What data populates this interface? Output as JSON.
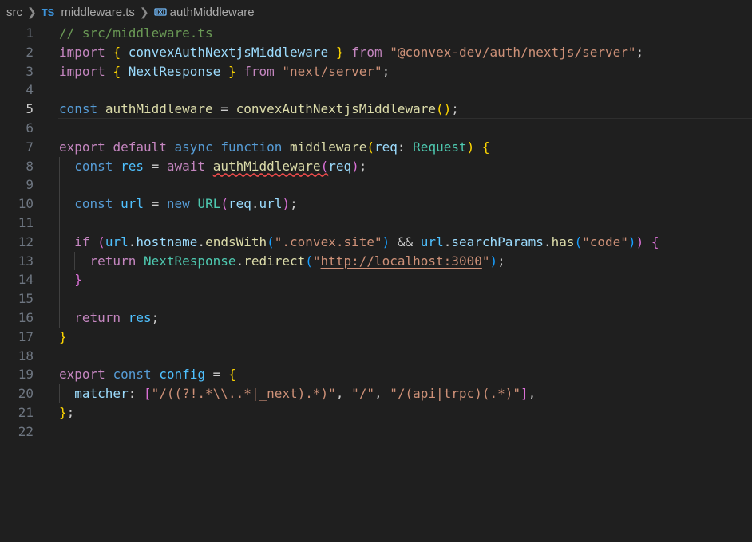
{
  "breadcrumb": {
    "folder": "src",
    "file_icon": "TS",
    "file": "middleware.ts",
    "symbol_icon": "symbol-variable-icon",
    "symbol": "authMiddleware"
  },
  "lines": [
    {
      "n": "1",
      "tokens": [
        {
          "t": "// src/middleware.ts",
          "c": "cm"
        }
      ]
    },
    {
      "n": "2",
      "tokens": [
        {
          "t": "import",
          "c": "k1"
        },
        {
          "t": " ",
          "c": "pl"
        },
        {
          "t": "{",
          "c": "b1"
        },
        {
          "t": " ",
          "c": "pl"
        },
        {
          "t": "convexAuthNextjsMiddleware",
          "c": "id"
        },
        {
          "t": " ",
          "c": "pl"
        },
        {
          "t": "}",
          "c": "b1"
        },
        {
          "t": " ",
          "c": "pl"
        },
        {
          "t": "from",
          "c": "k1"
        },
        {
          "t": " ",
          "c": "pl"
        },
        {
          "t": "\"@convex-dev/auth/nextjs/server\"",
          "c": "str"
        },
        {
          "t": ";",
          "c": "pl"
        }
      ]
    },
    {
      "n": "3",
      "tokens": [
        {
          "t": "import",
          "c": "k1"
        },
        {
          "t": " ",
          "c": "pl"
        },
        {
          "t": "{",
          "c": "b1"
        },
        {
          "t": " ",
          "c": "pl"
        },
        {
          "t": "NextResponse",
          "c": "id"
        },
        {
          "t": " ",
          "c": "pl"
        },
        {
          "t": "}",
          "c": "b1"
        },
        {
          "t": " ",
          "c": "pl"
        },
        {
          "t": "from",
          "c": "k1"
        },
        {
          "t": " ",
          "c": "pl"
        },
        {
          "t": "\"next/server\"",
          "c": "str"
        },
        {
          "t": ";",
          "c": "pl"
        }
      ]
    },
    {
      "n": "4",
      "tokens": []
    },
    {
      "n": "5",
      "current": true,
      "tokens": [
        {
          "t": "const",
          "c": "k2"
        },
        {
          "t": " ",
          "c": "pl"
        },
        {
          "t": "authMiddleware",
          "c": "fn"
        },
        {
          "t": " = ",
          "c": "pl"
        },
        {
          "t": "convexAuthNextjsMiddleware",
          "c": "fn"
        },
        {
          "t": "()",
          "c": "b1"
        },
        {
          "t": ";",
          "c": "pl"
        }
      ]
    },
    {
      "n": "6",
      "tokens": []
    },
    {
      "n": "7",
      "tokens": [
        {
          "t": "export",
          "c": "k1"
        },
        {
          "t": " ",
          "c": "pl"
        },
        {
          "t": "default",
          "c": "k1"
        },
        {
          "t": " ",
          "c": "pl"
        },
        {
          "t": "async",
          "c": "k2"
        },
        {
          "t": " ",
          "c": "pl"
        },
        {
          "t": "function",
          "c": "k2"
        },
        {
          "t": " ",
          "c": "pl"
        },
        {
          "t": "middleware",
          "c": "fn"
        },
        {
          "t": "(",
          "c": "b1"
        },
        {
          "t": "req",
          "c": "id"
        },
        {
          "t": ": ",
          "c": "pl"
        },
        {
          "t": "Request",
          "c": "ty"
        },
        {
          "t": ")",
          "c": "b1"
        },
        {
          "t": " ",
          "c": "pl"
        },
        {
          "t": "{",
          "c": "b1"
        }
      ]
    },
    {
      "n": "8",
      "guides": [
        1
      ],
      "tokens": [
        {
          "t": "  ",
          "c": "pl"
        },
        {
          "t": "const",
          "c": "k2"
        },
        {
          "t": " ",
          "c": "pl"
        },
        {
          "t": "res",
          "c": "cn"
        },
        {
          "t": " = ",
          "c": "pl"
        },
        {
          "t": "await",
          "c": "k1"
        },
        {
          "t": " ",
          "c": "pl"
        },
        {
          "t": "authMiddleware",
          "c": "fn squig"
        },
        {
          "t": "(",
          "c": "b2 squig"
        },
        {
          "t": "req",
          "c": "id"
        },
        {
          "t": ")",
          "c": "b2"
        },
        {
          "t": ";",
          "c": "pl"
        }
      ]
    },
    {
      "n": "9",
      "guides": [
        1
      ],
      "tokens": []
    },
    {
      "n": "10",
      "guides": [
        1
      ],
      "tokens": [
        {
          "t": "  ",
          "c": "pl"
        },
        {
          "t": "const",
          "c": "k2"
        },
        {
          "t": " ",
          "c": "pl"
        },
        {
          "t": "url",
          "c": "cn"
        },
        {
          "t": " = ",
          "c": "pl"
        },
        {
          "t": "new",
          "c": "k2"
        },
        {
          "t": " ",
          "c": "pl"
        },
        {
          "t": "URL",
          "c": "ty"
        },
        {
          "t": "(",
          "c": "b2"
        },
        {
          "t": "req",
          "c": "id"
        },
        {
          "t": ".",
          "c": "pl"
        },
        {
          "t": "url",
          "c": "id"
        },
        {
          "t": ")",
          "c": "b2"
        },
        {
          "t": ";",
          "c": "pl"
        }
      ]
    },
    {
      "n": "11",
      "guides": [
        1
      ],
      "tokens": []
    },
    {
      "n": "12",
      "guides": [
        1
      ],
      "tokens": [
        {
          "t": "  ",
          "c": "pl"
        },
        {
          "t": "if",
          "c": "k1"
        },
        {
          "t": " ",
          "c": "pl"
        },
        {
          "t": "(",
          "c": "b2"
        },
        {
          "t": "url",
          "c": "cn"
        },
        {
          "t": ".",
          "c": "pl"
        },
        {
          "t": "hostname",
          "c": "id"
        },
        {
          "t": ".",
          "c": "pl"
        },
        {
          "t": "endsWith",
          "c": "fn"
        },
        {
          "t": "(",
          "c": "b3"
        },
        {
          "t": "\".convex.site\"",
          "c": "str"
        },
        {
          "t": ")",
          "c": "b3"
        },
        {
          "t": " && ",
          "c": "pl"
        },
        {
          "t": "url",
          "c": "cn"
        },
        {
          "t": ".",
          "c": "pl"
        },
        {
          "t": "searchParams",
          "c": "id"
        },
        {
          "t": ".",
          "c": "pl"
        },
        {
          "t": "has",
          "c": "fn"
        },
        {
          "t": "(",
          "c": "b3"
        },
        {
          "t": "\"code\"",
          "c": "str"
        },
        {
          "t": ")",
          "c": "b3"
        },
        {
          "t": ")",
          "c": "b2"
        },
        {
          "t": " ",
          "c": "pl"
        },
        {
          "t": "{",
          "c": "b2"
        }
      ]
    },
    {
      "n": "13",
      "guides": [
        1,
        2
      ],
      "tokens": [
        {
          "t": "    ",
          "c": "pl"
        },
        {
          "t": "return",
          "c": "k1"
        },
        {
          "t": " ",
          "c": "pl"
        },
        {
          "t": "NextResponse",
          "c": "ty"
        },
        {
          "t": ".",
          "c": "pl"
        },
        {
          "t": "redirect",
          "c": "fn"
        },
        {
          "t": "(",
          "c": "b3"
        },
        {
          "t": "\"",
          "c": "str"
        },
        {
          "t": "http://localhost:3000",
          "c": "str link"
        },
        {
          "t": "\"",
          "c": "str"
        },
        {
          "t": ")",
          "c": "b3"
        },
        {
          "t": ";",
          "c": "pl"
        }
      ]
    },
    {
      "n": "14",
      "guides": [
        1
      ],
      "tokens": [
        {
          "t": "  ",
          "c": "pl"
        },
        {
          "t": "}",
          "c": "b2"
        }
      ]
    },
    {
      "n": "15",
      "guides": [
        1
      ],
      "tokens": []
    },
    {
      "n": "16",
      "guides": [
        1
      ],
      "tokens": [
        {
          "t": "  ",
          "c": "pl"
        },
        {
          "t": "return",
          "c": "k1"
        },
        {
          "t": " ",
          "c": "pl"
        },
        {
          "t": "res",
          "c": "cn"
        },
        {
          "t": ";",
          "c": "pl"
        }
      ]
    },
    {
      "n": "17",
      "tokens": [
        {
          "t": "}",
          "c": "b1"
        }
      ]
    },
    {
      "n": "18",
      "tokens": []
    },
    {
      "n": "19",
      "tokens": [
        {
          "t": "export",
          "c": "k1"
        },
        {
          "t": " ",
          "c": "pl"
        },
        {
          "t": "const",
          "c": "k2"
        },
        {
          "t": " ",
          "c": "pl"
        },
        {
          "t": "config",
          "c": "cn"
        },
        {
          "t": " = ",
          "c": "pl"
        },
        {
          "t": "{",
          "c": "b1"
        }
      ]
    },
    {
      "n": "20",
      "guides": [
        1
      ],
      "tokens": [
        {
          "t": "  ",
          "c": "pl"
        },
        {
          "t": "matcher",
          "c": "id"
        },
        {
          "t": ": ",
          "c": "pl"
        },
        {
          "t": "[",
          "c": "b2"
        },
        {
          "t": "\"/((?!.*\\\\..*|_next).*)\"",
          "c": "str"
        },
        {
          "t": ", ",
          "c": "pl"
        },
        {
          "t": "\"/\"",
          "c": "str"
        },
        {
          "t": ", ",
          "c": "pl"
        },
        {
          "t": "\"/(api|trpc)(.*)\"",
          "c": "str"
        },
        {
          "t": "]",
          "c": "b2"
        },
        {
          "t": ",",
          "c": "pl"
        }
      ]
    },
    {
      "n": "21",
      "tokens": [
        {
          "t": "}",
          "c": "b1"
        },
        {
          "t": ";",
          "c": "pl"
        }
      ]
    },
    {
      "n": "22",
      "tokens": []
    }
  ]
}
